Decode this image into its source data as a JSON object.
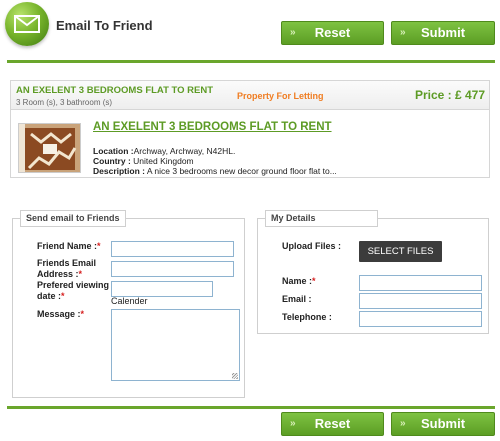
{
  "header": {
    "title": "Email To Friend",
    "logo_icon": "envelope-icon"
  },
  "actions": {
    "reset_label": "Reset",
    "submit_label": "Submit",
    "accent_color": "#6aa62c"
  },
  "listing": {
    "title": "AN EXELENT 3 BEDROOMS FLAT TO RENT",
    "rooms": "3 Room (s), 3 bathroom (s)",
    "type": "Property For Letting",
    "price": "Price : £ 477",
    "link_title": "AN EXELENT 3 BEDROOMS FLAT TO RENT",
    "location_label": "Location :",
    "location_value": "Archway, Archway, N42HL.",
    "country_label": "Country :",
    "country_value": " United Kingdom",
    "description_label": "Description :",
    "description_value": " A nice 3 bedrooms new decor ground floor flat to..."
  },
  "friend_form": {
    "legend": "Send email to Friends",
    "friend_name_label": "Friend Name :",
    "friends_email_label_line1": "Friends Email",
    "friends_email_label_line2": "Address :",
    "viewing_date_label_line1": "Prefered viewing",
    "viewing_date_label_line2": "date :",
    "calender_text": "Calender",
    "message_label": "Message :",
    "required_mark": "*"
  },
  "my_details": {
    "legend": "My Details",
    "upload_label": "Upload Files :",
    "select_files_label": "SELECT FILES",
    "name_label": "Name :",
    "email_label": "Email :",
    "telephone_label": "Telephone :",
    "required_mark": "*"
  }
}
